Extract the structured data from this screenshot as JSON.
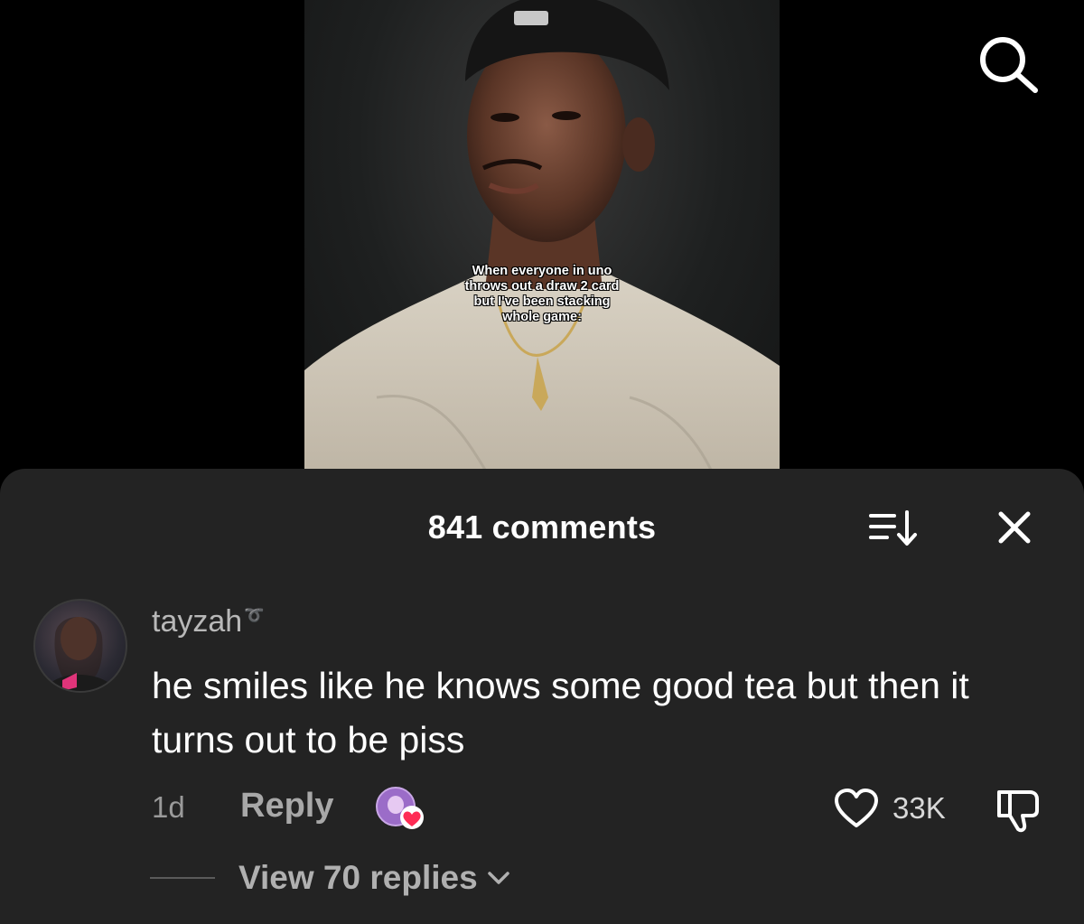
{
  "video": {
    "caption_lines": [
      "When everyone in uno",
      "throws out a draw 2 card",
      "but I've been stacking",
      "whole game:"
    ]
  },
  "icons": {
    "search": "search-icon",
    "sort": "sort-icon",
    "close": "close-icon",
    "like": "heart-icon",
    "dislike": "thumbs-down-icon",
    "expand": "chevron-down-icon"
  },
  "comments_sheet": {
    "title": "841 comments",
    "comment": {
      "username": "tayzah",
      "username_badge": "➰",
      "text": "he smiles like he knows some good tea but then it turns out to be piss",
      "time": "1d",
      "reply_label": "Reply",
      "like_count": "33K",
      "view_replies_label": "View 70 replies"
    }
  },
  "colors": {
    "sheet_bg": "#232323",
    "like_accent": "#fe2c55"
  }
}
